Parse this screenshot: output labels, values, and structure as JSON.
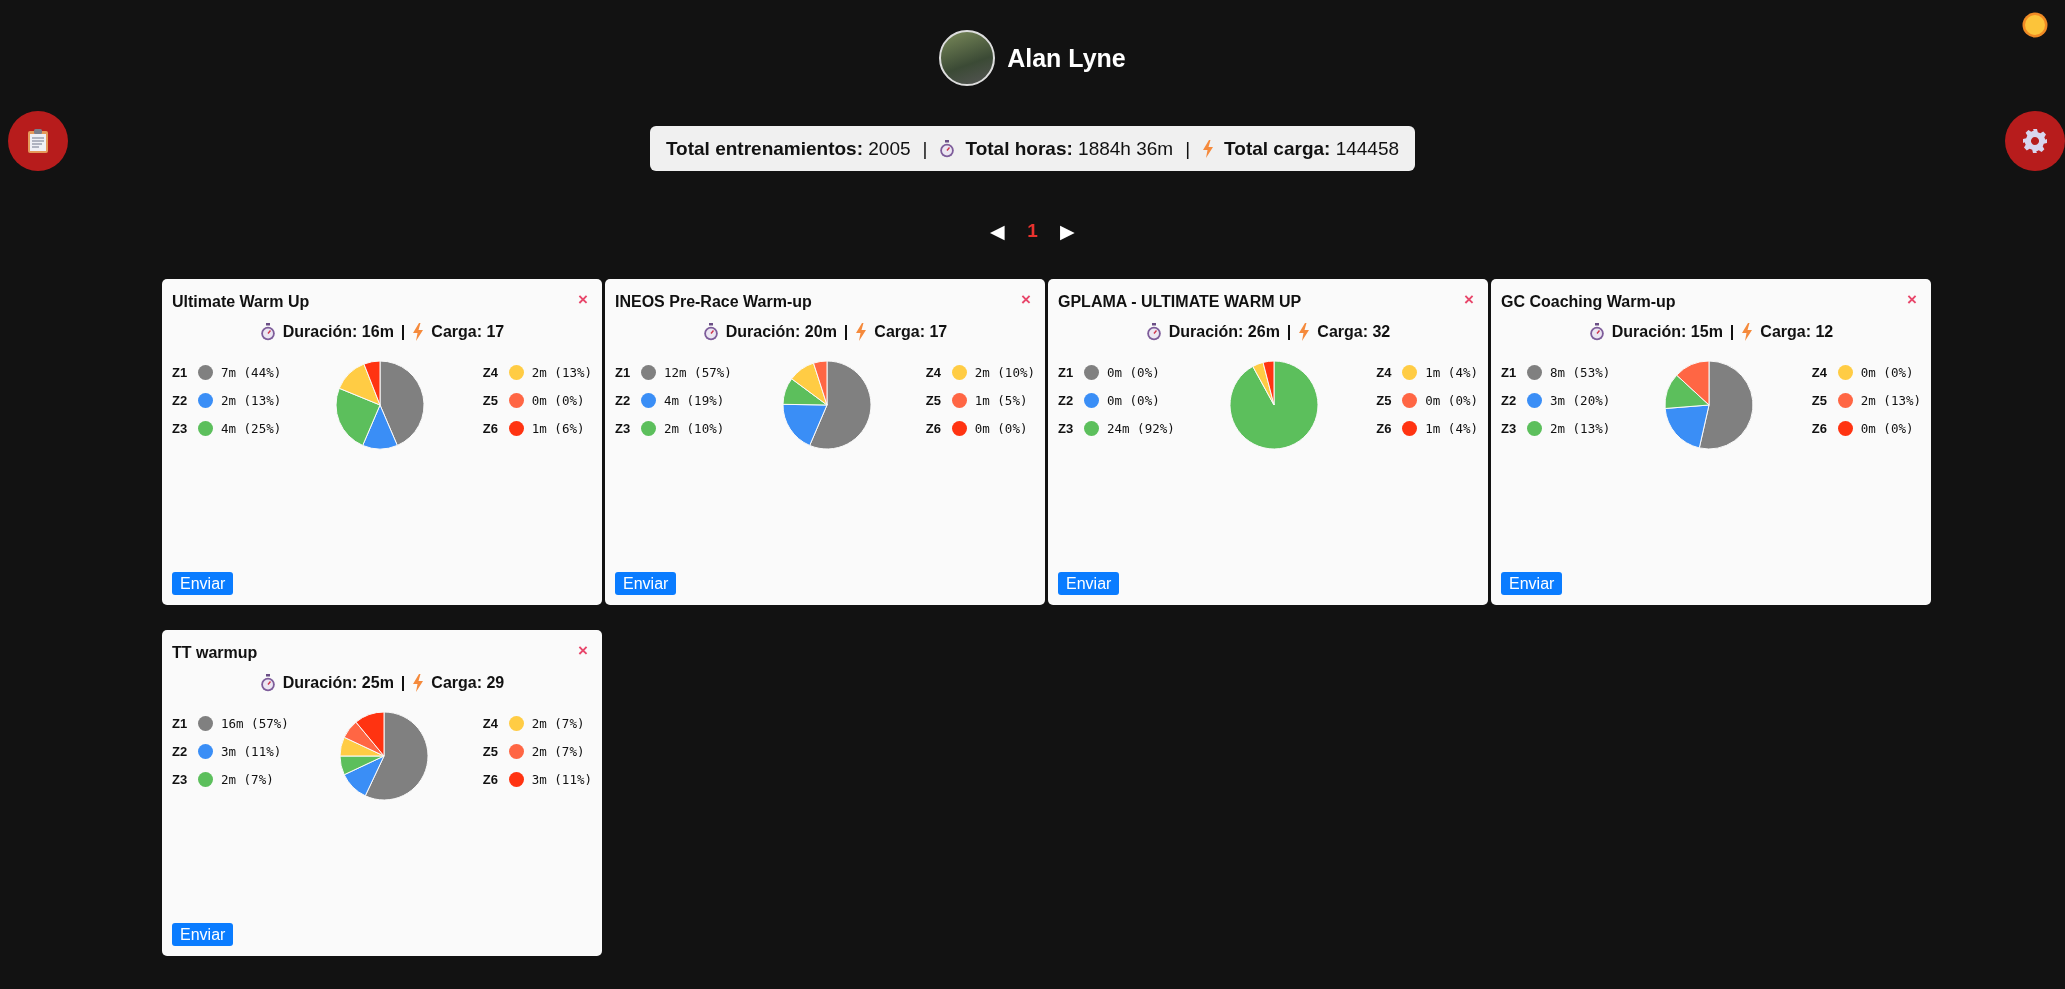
{
  "profile": {
    "name": "Alan Lyne"
  },
  "stats": {
    "items": [
      {
        "kind": "count",
        "text": "**Total entrenamientos:** 2005"
      },
      {
        "kind": "hours",
        "text": "**Total horas:** 1884h 36m"
      },
      {
        "kind": "load",
        "text": "**Total carga:** 144458"
      }
    ],
    "separators": [
      "|",
      "|"
    ]
  },
  "pagination": {
    "prev": "◀",
    "next": "▶",
    "pages": [
      {
        "label": "1",
        "selected": true
      }
    ]
  },
  "cards": [
    {
      "title": "Ultimate Warm Up",
      "close": "×",
      "duration": "Duración: 16m",
      "separator": "|",
      "load": "Carga: 17",
      "button": "Enviar",
      "zones": [
        {
          "color": "#808080",
          "time": "7m (44%)"
        },
        {
          "color": "#3a8ef6",
          "time": "2m (13%)"
        },
        {
          "color": "#5cbf5c",
          "time": "4m (25%)"
        },
        {
          "color": "#ffcc44",
          "time": "2m (13%)"
        },
        {
          "color": "#ff6644",
          "time": "0m (0%)"
        },
        {
          "color": "#ff3311",
          "time": "1m (6%)"
        }
      ],
      "chart_data": {
        "type": "pie",
        "categories": [
          "Z1",
          "Z2",
          "Z3",
          "Z4",
          "Z5",
          "Z6"
        ],
        "values": [
          44,
          13,
          25,
          13,
          0,
          6
        ]
      }
    },
    {
      "title": "INEOS Pre-Race Warm-up",
      "close": "×",
      "duration": "Duración: 20m",
      "separator": "|",
      "load": "Carga: 17",
      "button": "Enviar",
      "zones": [
        {
          "color": "#808080",
          "time": "12m (57%)"
        },
        {
          "color": "#3a8ef6",
          "time": "4m (19%)"
        },
        {
          "color": "#5cbf5c",
          "time": "2m (10%)"
        },
        {
          "color": "#ffcc44",
          "time": "2m (10%)"
        },
        {
          "color": "#ff6644",
          "time": "1m (5%)"
        },
        {
          "color": "#ff3311",
          "time": "0m (0%)"
        }
      ],
      "chart_data": {
        "type": "pie",
        "categories": [
          "Z1",
          "Z2",
          "Z3",
          "Z4",
          "Z5",
          "Z6"
        ],
        "values": [
          57,
          19,
          10,
          10,
          5,
          0
        ]
      }
    },
    {
      "title": "GPLAMA - ULTIMATE WARM UP",
      "close": "×",
      "duration": "Duración: 26m",
      "separator": "|",
      "load": "Carga: 32",
      "button": "Enviar",
      "zones": [
        {
          "color": "#808080",
          "time": "0m (0%)"
        },
        {
          "color": "#3a8ef6",
          "time": "0m (0%)"
        },
        {
          "color": "#5cbf5c",
          "time": "24m (92%)"
        },
        {
          "color": "#ffcc44",
          "time": "1m (4%)"
        },
        {
          "color": "#ff6644",
          "time": "0m (0%)"
        },
        {
          "color": "#ff3311",
          "time": "1m (4%)"
        }
      ],
      "chart_data": {
        "type": "pie",
        "categories": [
          "Z1",
          "Z2",
          "Z3",
          "Z4",
          "Z5",
          "Z6"
        ],
        "values": [
          0,
          0,
          92,
          4,
          0,
          4
        ]
      }
    },
    {
      "title": "GC Coaching Warm-up",
      "close": "×",
      "duration": "Duración: 15m",
      "separator": "|",
      "load": "Carga: 12",
      "button": "Enviar",
      "zones": [
        {
          "color": "#808080",
          "time": "8m (53%)"
        },
        {
          "color": "#3a8ef6",
          "time": "3m (20%)"
        },
        {
          "color": "#5cbf5c",
          "time": "2m (13%)"
        },
        {
          "color": "#ffcc44",
          "time": "0m (0%)"
        },
        {
          "color": "#ff6644",
          "time": "2m (13%)"
        },
        {
          "color": "#ff3311",
          "time": "0m (0%)"
        }
      ],
      "chart_data": {
        "type": "pie",
        "categories": [
          "Z1",
          "Z2",
          "Z3",
          "Z4",
          "Z5",
          "Z6"
        ],
        "values": [
          53,
          20,
          13,
          0,
          13,
          0
        ]
      }
    },
    {
      "title": "TT warmup",
      "close": "×",
      "duration": "Duración: 25m",
      "separator": "|",
      "load": "Carga: 29",
      "button": "Enviar",
      "zones": [
        {
          "color": "#808080",
          "time": "16m (57%)"
        },
        {
          "color": "#3a8ef6",
          "time": "3m (11%)"
        },
        {
          "color": "#5cbf5c",
          "time": "2m (7%)"
        },
        {
          "color": "#ffcc44",
          "time": "2m (7%)"
        },
        {
          "color": "#ff6644",
          "time": "2m (7%)"
        },
        {
          "color": "#ff3311",
          "time": "3m (11%)"
        }
      ],
      "chart_data": {
        "type": "pie",
        "categories": [
          "Z1",
          "Z2",
          "Z3",
          "Z4",
          "Z5",
          "Z6"
        ],
        "values": [
          57,
          11,
          7,
          7,
          7,
          11
        ]
      }
    }
  ]
}
